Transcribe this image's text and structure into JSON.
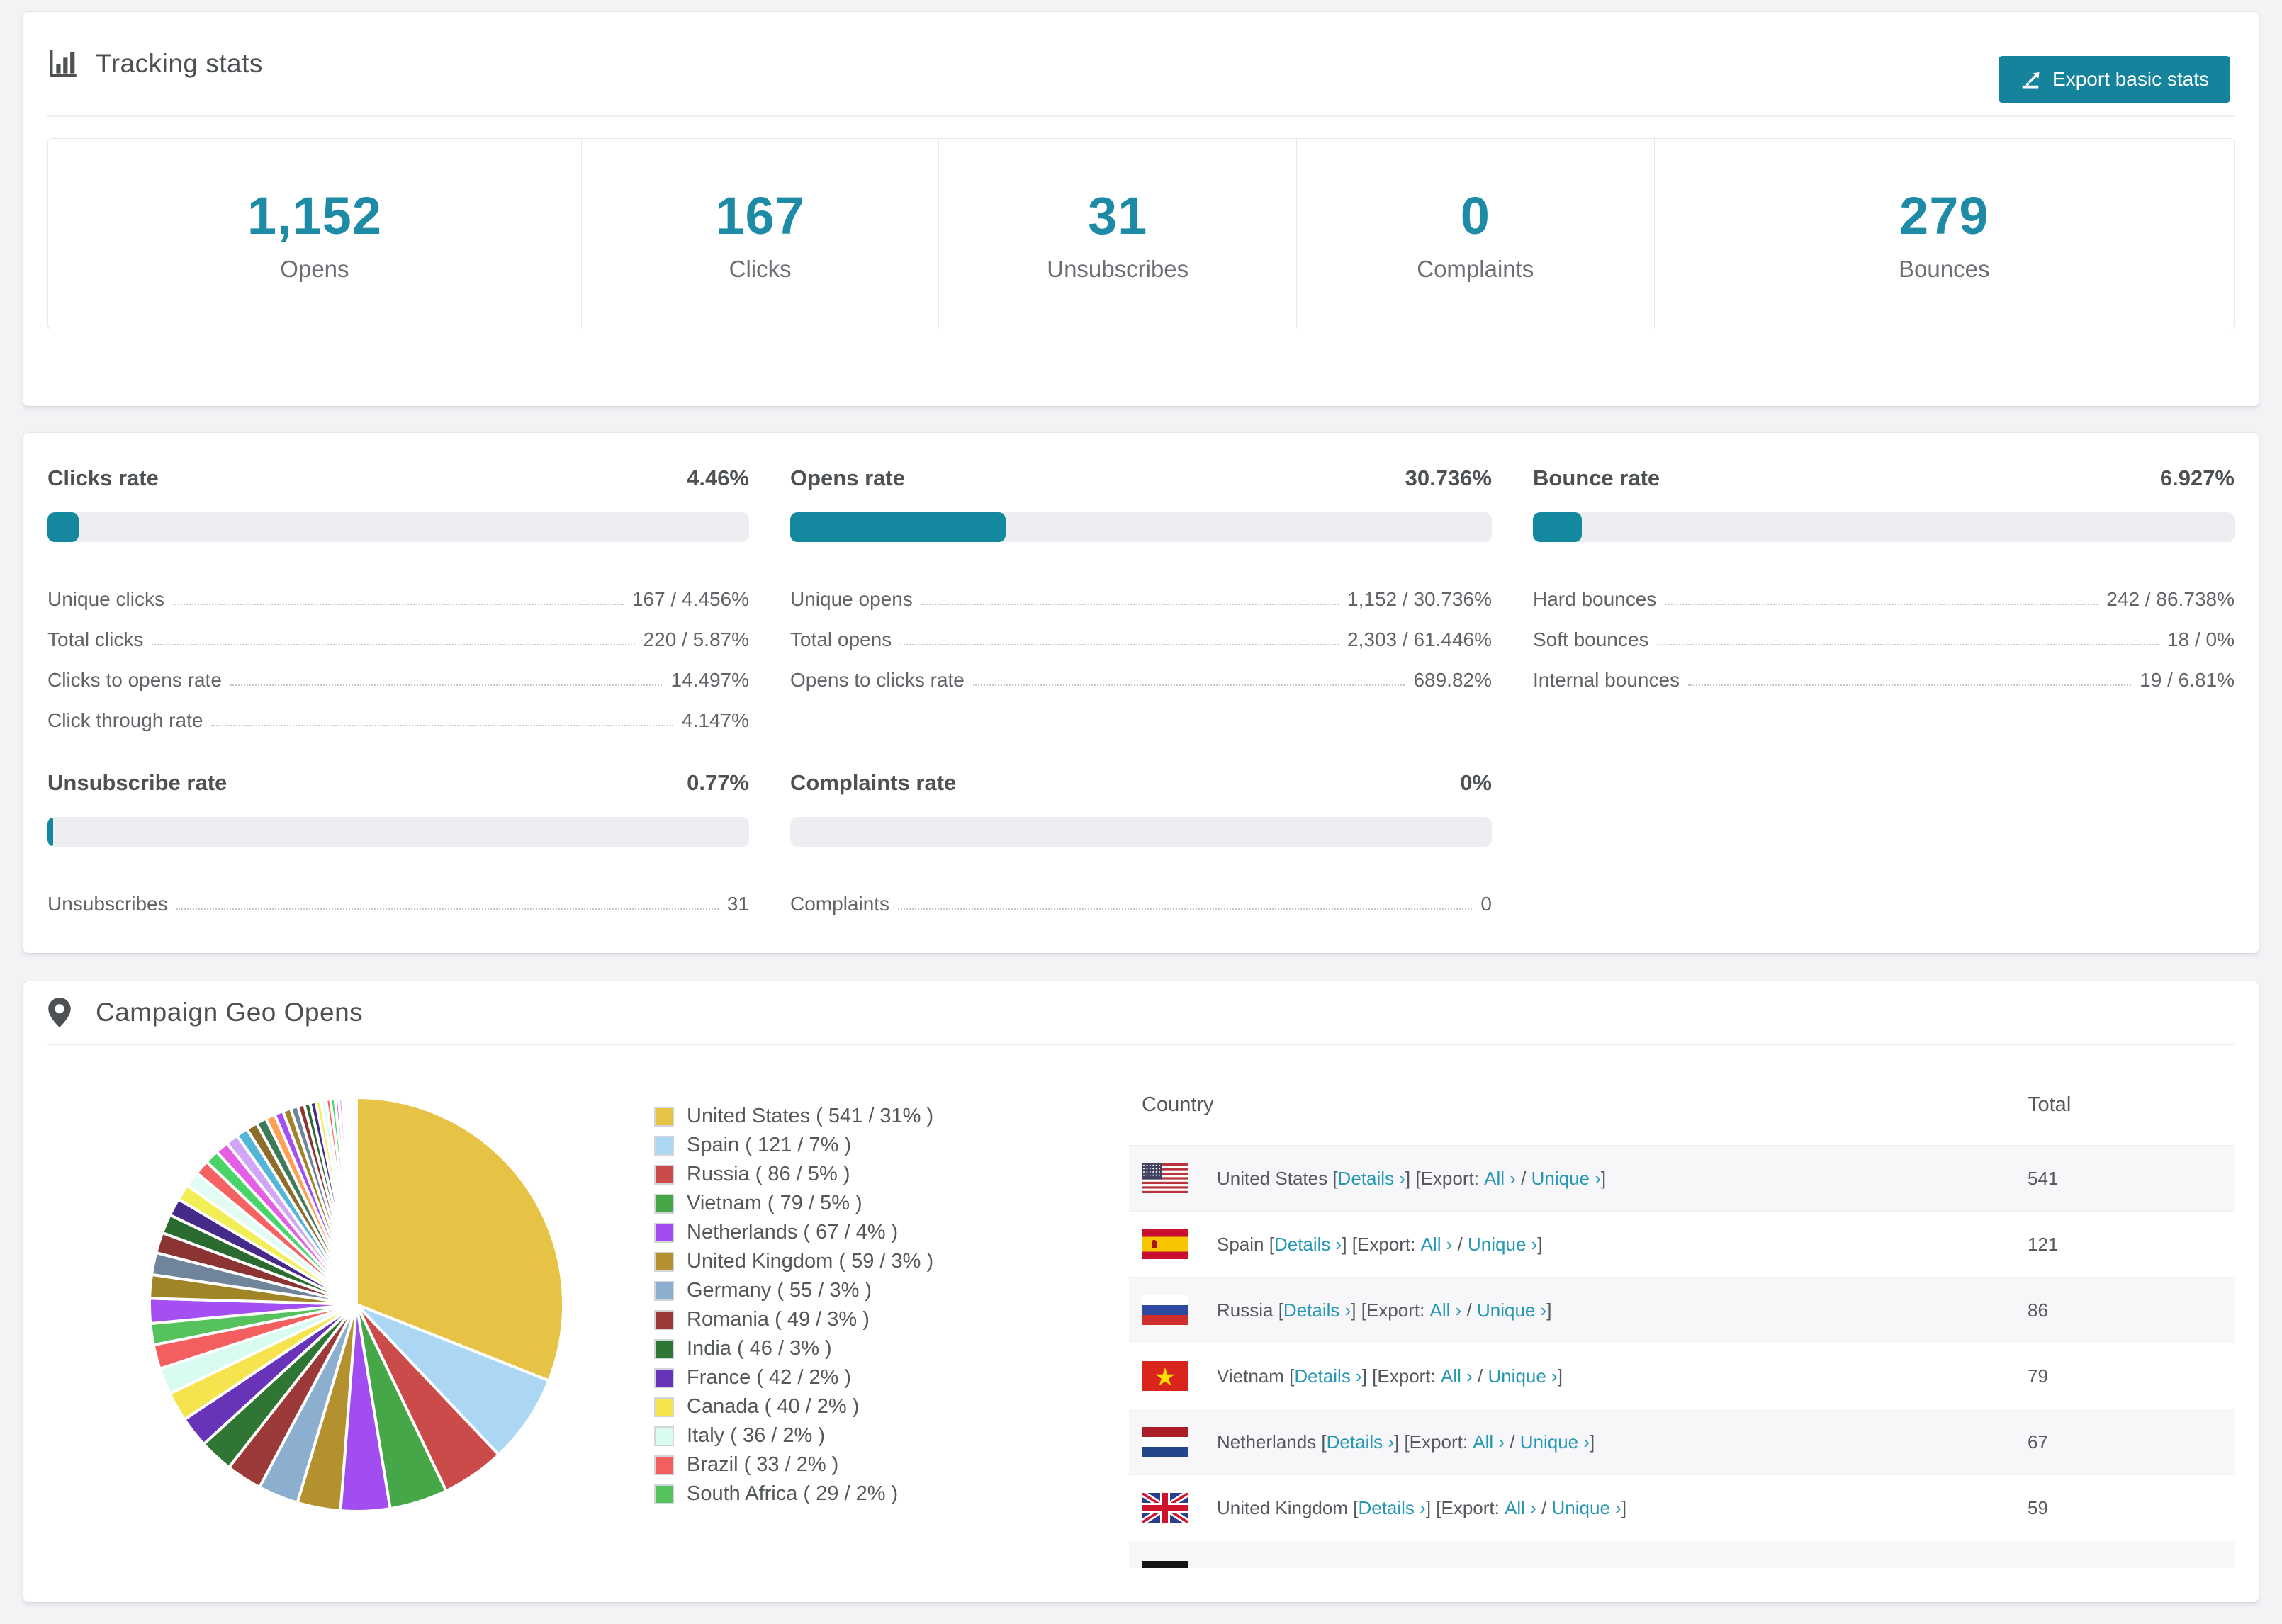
{
  "colors": {
    "accent": "#1d8ba6",
    "button": "#16839d",
    "link": "#2798b4",
    "bar_fill": "#14889f",
    "bar_track": "#edeef1",
    "row_stripe": "#f7f7f9"
  },
  "tracking_stats": {
    "title": "Tracking stats",
    "export_button": "Export basic stats",
    "stats": [
      {
        "value": "1,152",
        "label": "Opens"
      },
      {
        "value": "167",
        "label": "Clicks"
      },
      {
        "value": "31",
        "label": "Unsubscribes"
      },
      {
        "value": "0",
        "label": "Complaints"
      },
      {
        "value": "279",
        "label": "Bounces"
      }
    ]
  },
  "rates": {
    "sections": [
      {
        "title": "Clicks rate",
        "value": "4.46%",
        "percent": 4.46,
        "rows": [
          [
            "Unique clicks",
            "167 / 4.456%"
          ],
          [
            "Total clicks",
            "220 / 5.87%"
          ],
          [
            "Clicks to opens rate",
            "14.497%"
          ],
          [
            "Click through rate",
            "4.147%"
          ]
        ]
      },
      {
        "title": "Opens rate",
        "value": "30.736%",
        "percent": 30.736,
        "rows": [
          [
            "Unique opens",
            "1,152 / 30.736%"
          ],
          [
            "Total opens",
            "2,303 / 61.446%"
          ],
          [
            "Opens to clicks rate",
            "689.82%"
          ]
        ]
      },
      {
        "title": "Bounce rate",
        "value": "6.927%",
        "percent": 6.927,
        "rows": [
          [
            "Hard bounces",
            "242 / 86.738%"
          ],
          [
            "Soft bounces",
            "18 / 0%"
          ],
          [
            "Internal bounces",
            "19 / 6.81%"
          ]
        ]
      },
      {
        "title": "Unsubscribe rate",
        "value": "0.77%",
        "percent": 0.77,
        "rows": [
          [
            "Unsubscribes",
            "31"
          ]
        ]
      },
      {
        "title": "Complaints rate",
        "value": "0%",
        "percent": 0,
        "rows": [
          [
            "Complaints",
            "0"
          ]
        ]
      }
    ]
  },
  "geo": {
    "title": "Campaign Geo Opens",
    "link_labels": {
      "details": "Details",
      "export": "Export:",
      "all": "All",
      "unique": "Unique",
      "chevron": "›"
    },
    "table": {
      "columns": [
        "Country",
        "Total"
      ],
      "rows": [
        {
          "country": "United States",
          "flag": "us",
          "total": "541"
        },
        {
          "country": "Spain",
          "flag": "es",
          "total": "121"
        },
        {
          "country": "Russia",
          "flag": "ru",
          "total": "86"
        },
        {
          "country": "Vietnam",
          "flag": "vn",
          "total": "79"
        },
        {
          "country": "Netherlands",
          "flag": "nl",
          "total": "67"
        },
        {
          "country": "United Kingdom",
          "flag": "gb",
          "total": "59"
        }
      ],
      "partial_row_flag": "de"
    }
  },
  "chart_data": {
    "type": "pie",
    "title": "Campaign Geo Opens",
    "legend_position": "right-of-pie",
    "start_angle_deg": -90,
    "direction": "clockwise",
    "slices": [
      {
        "name": "United States",
        "value": 541,
        "pct": 31,
        "color": "#e7c345"
      },
      {
        "name": "Spain",
        "value": 121,
        "pct": 7,
        "color": "#abd7f4"
      },
      {
        "name": "Russia",
        "value": 86,
        "pct": 5,
        "color": "#cb4a4a"
      },
      {
        "name": "Vietnam",
        "value": 79,
        "pct": 5,
        "color": "#46a749"
      },
      {
        "name": "Netherlands",
        "value": 67,
        "pct": 4,
        "color": "#a14df0"
      },
      {
        "name": "United Kingdom",
        "value": 59,
        "pct": 3,
        "color": "#b3912f"
      },
      {
        "name": "Germany",
        "value": 55,
        "pct": 3,
        "color": "#8caecf"
      },
      {
        "name": "Romania",
        "value": 49,
        "pct": 3,
        "color": "#9c3a3a"
      },
      {
        "name": "India",
        "value": 46,
        "pct": 3,
        "color": "#2f7533"
      },
      {
        "name": "France",
        "value": 42,
        "pct": 2,
        "color": "#6733b9"
      },
      {
        "name": "Canada",
        "value": 40,
        "pct": 2,
        "color": "#f6e44f"
      },
      {
        "name": "Italy",
        "value": 36,
        "pct": 2,
        "color": "#d8fcf0"
      },
      {
        "name": "Brazil",
        "value": 33,
        "pct": 2,
        "color": "#f35f5f"
      },
      {
        "name": "South Africa",
        "value": 29,
        "pct": 2,
        "color": "#55c25d"
      }
    ],
    "others": {
      "note": "remaining small unlabeled slices",
      "values": [
        34,
        32,
        30,
        28,
        26,
        24,
        22,
        21,
        20,
        19,
        18,
        17,
        16,
        15,
        14,
        13,
        12,
        11,
        10,
        9,
        8,
        8,
        7,
        7,
        6,
        6,
        5,
        5,
        4,
        4,
        3,
        3,
        2,
        2,
        1
      ],
      "colors_cycle": [
        "#a44ff2",
        "#a08426",
        "#70849b",
        "#8c3434",
        "#2b6b30",
        "#452a8a",
        "#f2ee55",
        "#e2fbf3",
        "#f56262",
        "#49d468",
        "#e45fe4",
        "#d2a6f7",
        "#53b6d8",
        "#8c6d2a",
        "#3f7a5a",
        "#ff9f55"
      ]
    }
  }
}
